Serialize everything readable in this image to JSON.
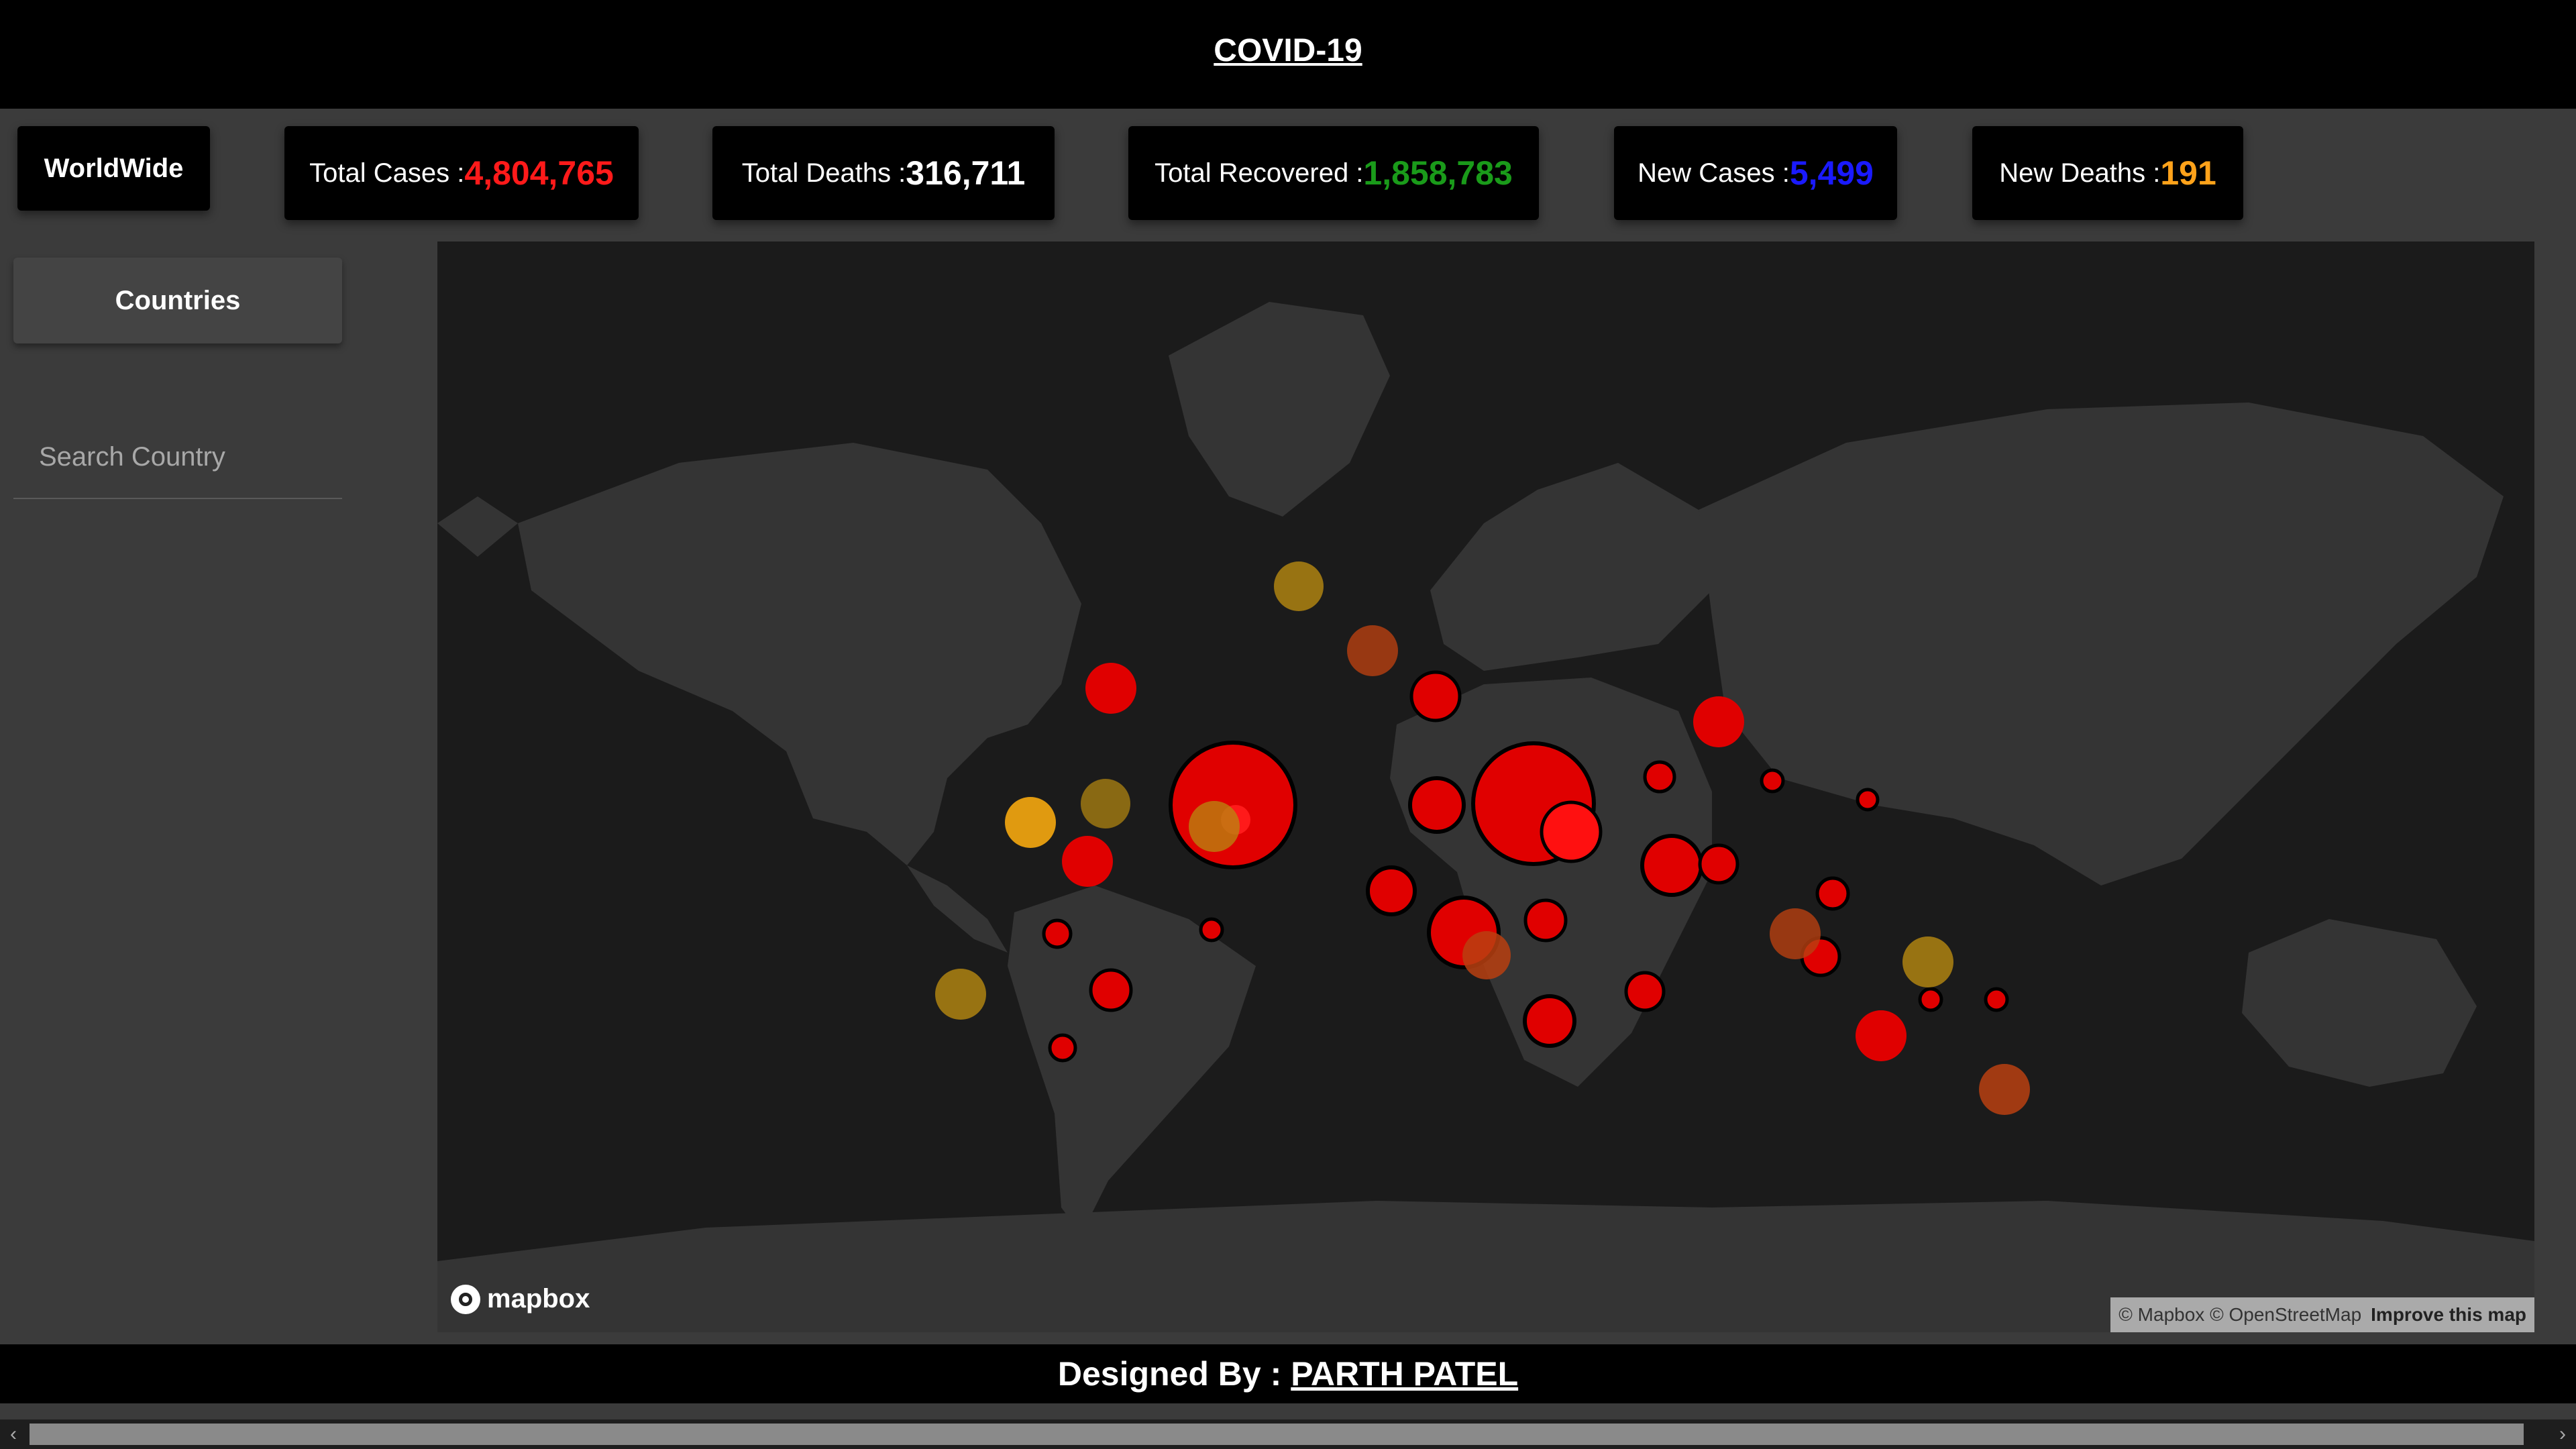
{
  "header": {
    "title": "COVID-19"
  },
  "stats": {
    "worldwide_label": "WorldWide",
    "total_cases_label": "Total Cases : ",
    "total_cases": "4,804,765",
    "total_deaths_label": "Total Deaths : ",
    "total_deaths": "316,711",
    "total_recovered_label": "Total Recovered : ",
    "total_recovered": "1,858,783",
    "new_cases_label": "New Cases : ",
    "new_cases": "5,499",
    "new_deaths_label": "New Deaths : ",
    "new_deaths": "191"
  },
  "colors": {
    "cases": "#ff1a1a",
    "deaths": "#ffffff",
    "recovered": "#1a9b1a",
    "new_cases": "#1a1aff",
    "new_deaths": "#ffa21a",
    "bubble": "#e00000"
  },
  "sidebar": {
    "countries_label": "Countries",
    "search_placeholder": "Search Country"
  },
  "map": {
    "logo_text": "mapbox",
    "attribution": "© Mapbox © OpenStreetMap",
    "improve_label": "Improve this map"
  },
  "footer": {
    "prefix": "Designed By : ",
    "name": "PARTH PATEL"
  },
  "scrollbar": {
    "left_arrow": "‹",
    "right_arrow": "›"
  }
}
